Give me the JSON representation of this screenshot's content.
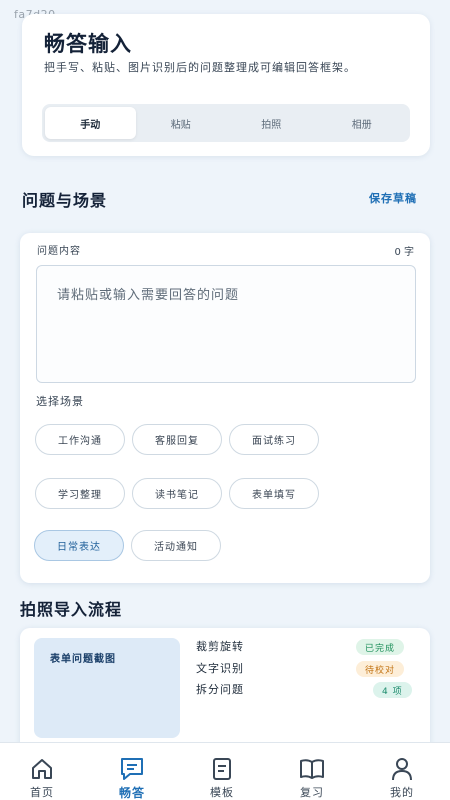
{
  "watermark": "fa7d20",
  "header": {
    "title": "畅答输入",
    "description": "把手写、粘贴、图片识别后的问题整理成可编辑回答框架。",
    "tabs": [
      {
        "label": "手动",
        "active": true
      },
      {
        "label": "粘贴",
        "active": false
      },
      {
        "label": "拍照",
        "active": false
      },
      {
        "label": "相册",
        "active": false
      }
    ]
  },
  "question_section": {
    "title": "问题与场景",
    "save_label": "保存草稿",
    "content_label": "问题内容",
    "char_count": "0 字",
    "placeholder": "请粘贴或输入需要回答的问题",
    "scene_label": "选择场景",
    "scenes": [
      "工作沟通",
      "客服回复",
      "面试练习",
      "学习整理",
      "读书笔记",
      "表单填写",
      "日常表达",
      "活动通知"
    ],
    "selected_scene": "日常表达"
  },
  "photo_section": {
    "title": "拍照导入流程",
    "thumb_label": "表单问题截图",
    "steps": [
      {
        "name": "裁剪旋转",
        "status": "已完成",
        "status_color": "#1e8f5a",
        "status_bg": "#dff4e8"
      },
      {
        "name": "文字识别",
        "status": "待校对",
        "status_color": "#c27414",
        "status_bg": "#fdeed8"
      },
      {
        "name": "拆分问题",
        "status": "4 项",
        "status_color": "#1a8a6b",
        "status_bg": "#dcf3ec"
      }
    ]
  },
  "nav": {
    "items": [
      {
        "label": "首页",
        "icon": "home-icon"
      },
      {
        "label": "畅答",
        "icon": "chat-icon",
        "active": true
      },
      {
        "label": "模板",
        "icon": "document-icon"
      },
      {
        "label": "复习",
        "icon": "book-icon"
      },
      {
        "label": "我的",
        "icon": "user-icon"
      }
    ]
  },
  "colors": {
    "accent": "#1f6fb5",
    "background": "#eef4fa",
    "selected_chip_bg": "#e3effa"
  }
}
